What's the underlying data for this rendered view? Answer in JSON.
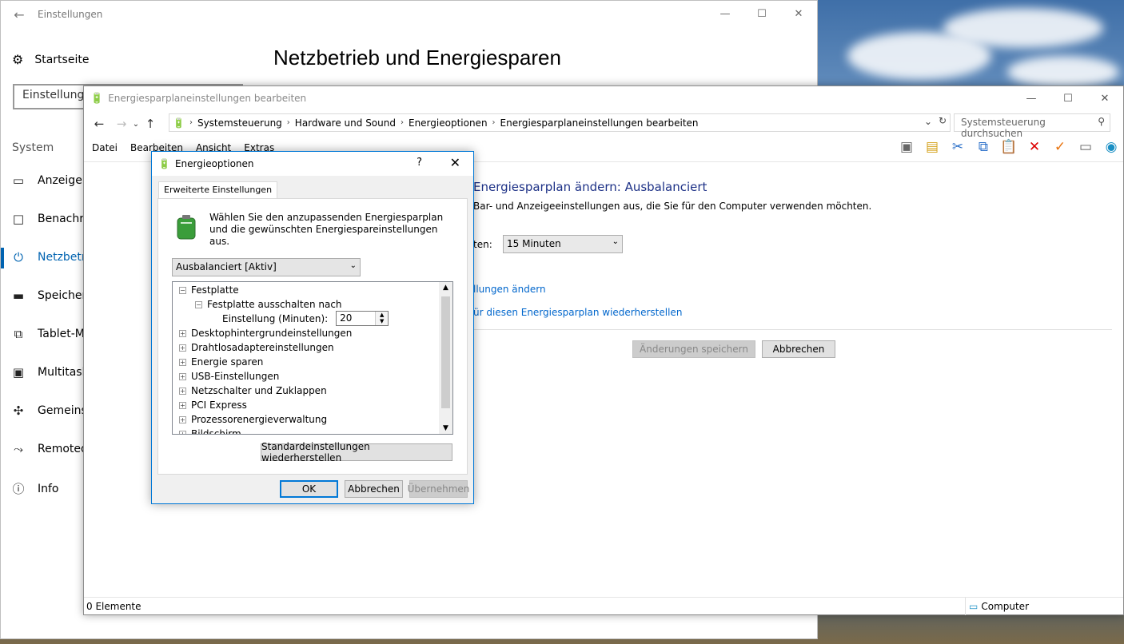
{
  "settings": {
    "title": "Einstellungen",
    "home_label": "Startseite",
    "search_placeholder": "Einstellung s",
    "page_title": "Netzbetrieb und Energiesparen",
    "section_label": "System",
    "nav_items": [
      {
        "label": "Anzeige",
        "icon": "display-icon"
      },
      {
        "label": "Benachri",
        "icon": "notifications-icon"
      },
      {
        "label": "Netzbetri",
        "icon": "power-icon"
      },
      {
        "label": "Speicher",
        "icon": "storage-icon"
      },
      {
        "label": "Tablet-M",
        "icon": "tablet-icon"
      },
      {
        "label": "Multitask",
        "icon": "multitasking-icon"
      },
      {
        "label": "Gemeins",
        "icon": "shared-icon"
      },
      {
        "label": "Remoted",
        "icon": "remote-icon"
      },
      {
        "label": "Info",
        "icon": "info-icon"
      }
    ]
  },
  "cpl": {
    "title": "Energiesparplaneinstellungen bearbeiten",
    "breadcrumb": [
      "Systemsteuerung",
      "Hardware und Sound",
      "Energieoptionen",
      "Energiesparplaneinstellungen bearbeiten"
    ],
    "search_placeholder": "Systemsteuerung durchsuchen",
    "menu": [
      "Datei",
      "Bearbeiten",
      "Ansicht",
      "Extras"
    ],
    "heading": "Energiesparplan ändern: Ausbalanciert",
    "description": "Bar- und Anzeigeeinstellungen aus, die Sie für den Computer verwenden möchten.",
    "turnoff_label": "ten:",
    "turnoff_value": "15 Minuten",
    "link_advanced": "llungen ändern",
    "link_restore": "ür diesen Energiesparplan wiederherstellen",
    "save_button": "Änderungen speichern",
    "cancel_button": "Abbrechen",
    "status_items": "0 Elemente",
    "status_location": "Computer"
  },
  "dialog": {
    "title": "Energieoptionen",
    "help": "?",
    "tab": "Erweiterte Einstellungen",
    "intro": "Wählen Sie den anzupassenden Energiesparplan und die gewünschten Energiespareinstellungen aus.",
    "plan_selected": "Ausbalanciert [Aktiv]",
    "tree": {
      "festplatte": "Festplatte",
      "festplatte_aus": "Festplatte ausschalten nach",
      "einstellung_label": "Einstellung (Minuten):",
      "einstellung_value": "20",
      "items": [
        "Desktophintergrundeinstellungen",
        "Drahtlosadaptereinstellungen",
        "Energie sparen",
        "USB-Einstellungen",
        "Netzschalter und Zuklappen",
        "PCI Express",
        "Prozessorenergieverwaltung",
        "Bildschirm"
      ]
    },
    "restore_defaults": "Standardeinstellungen wiederherstellen",
    "ok": "OK",
    "cancel": "Abbrechen",
    "apply": "Übernehmen"
  }
}
